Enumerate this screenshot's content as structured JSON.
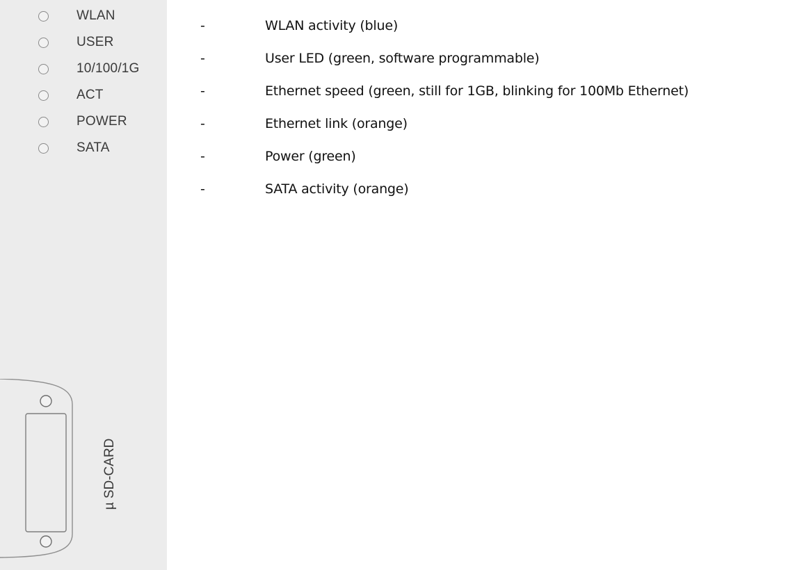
{
  "panel": {
    "leds": [
      {
        "label": "WLAN"
      },
      {
        "label": "USER"
      },
      {
        "label": "10/100/1G"
      },
      {
        "label": "ACT"
      },
      {
        "label": "POWER"
      },
      {
        "label": "SATA"
      }
    ],
    "sd_card_label": "µ SD-CARD"
  },
  "legend": [
    {
      "dash": "-",
      "text": "WLAN activity (blue)"
    },
    {
      "dash": "-",
      "text": "User LED (green, software programmable)"
    },
    {
      "dash": "-",
      "text": "Ethernet speed (green, still for 1GB, blinking for 100Mb Ethernet)"
    },
    {
      "dash": "-",
      "text": "Ethernet link (orange)"
    },
    {
      "dash": "-",
      "text": "Power (green)"
    },
    {
      "dash": "-",
      "text": "SATA activity (orange)"
    }
  ]
}
